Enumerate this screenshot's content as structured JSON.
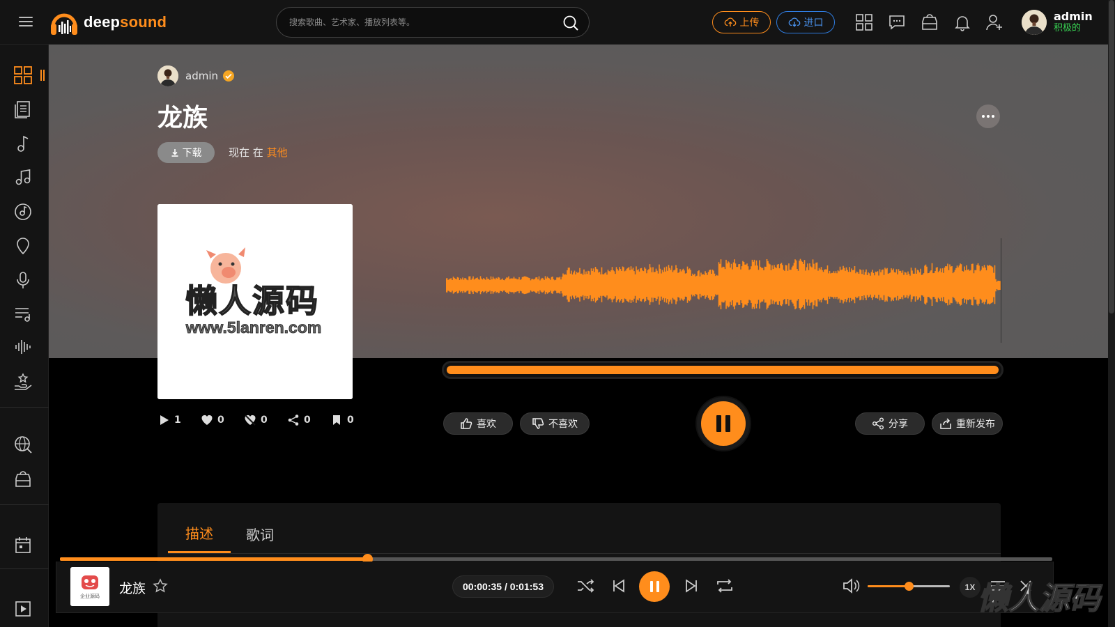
{
  "app": {
    "logo_word1": "deep",
    "logo_word2": "sound"
  },
  "search": {
    "placeholder": "搜索歌曲、艺术家、播放列表等。"
  },
  "header": {
    "upload_label": "上传",
    "import_label": "进口",
    "user_name": "admin",
    "user_status": "积极的"
  },
  "track": {
    "owner": "admin",
    "title": "龙族",
    "download_label": "下载",
    "now_in_prefix": "现在 在",
    "category": "其他",
    "progress_fraction": 1.0,
    "stats": {
      "plays": "1",
      "likes": "0",
      "dislikes": "0",
      "shares": "0",
      "saves": "0"
    },
    "like_label": "喜欢",
    "dislike_label": "不喜欢",
    "share_label": "分享",
    "repost_label": "重新发布"
  },
  "cover_watermark": {
    "line1": "懒人源码",
    "line2": "www.5lanren.com"
  },
  "tabs": {
    "description": "描述",
    "lyrics": "歌词"
  },
  "player": {
    "title": "龙族",
    "time": "00:00:35 / 0:01:53",
    "elapsed_fraction": 0.3097,
    "volume_fraction": 0.5,
    "speed": "1X",
    "thumb_text": "企业源码"
  },
  "corner_watermark": "懒人源码",
  "colors": {
    "accent": "#ff8d1c",
    "import": "#2f7de1",
    "status_green": "#39d353",
    "bg": "#000000",
    "panel": "#141414"
  }
}
